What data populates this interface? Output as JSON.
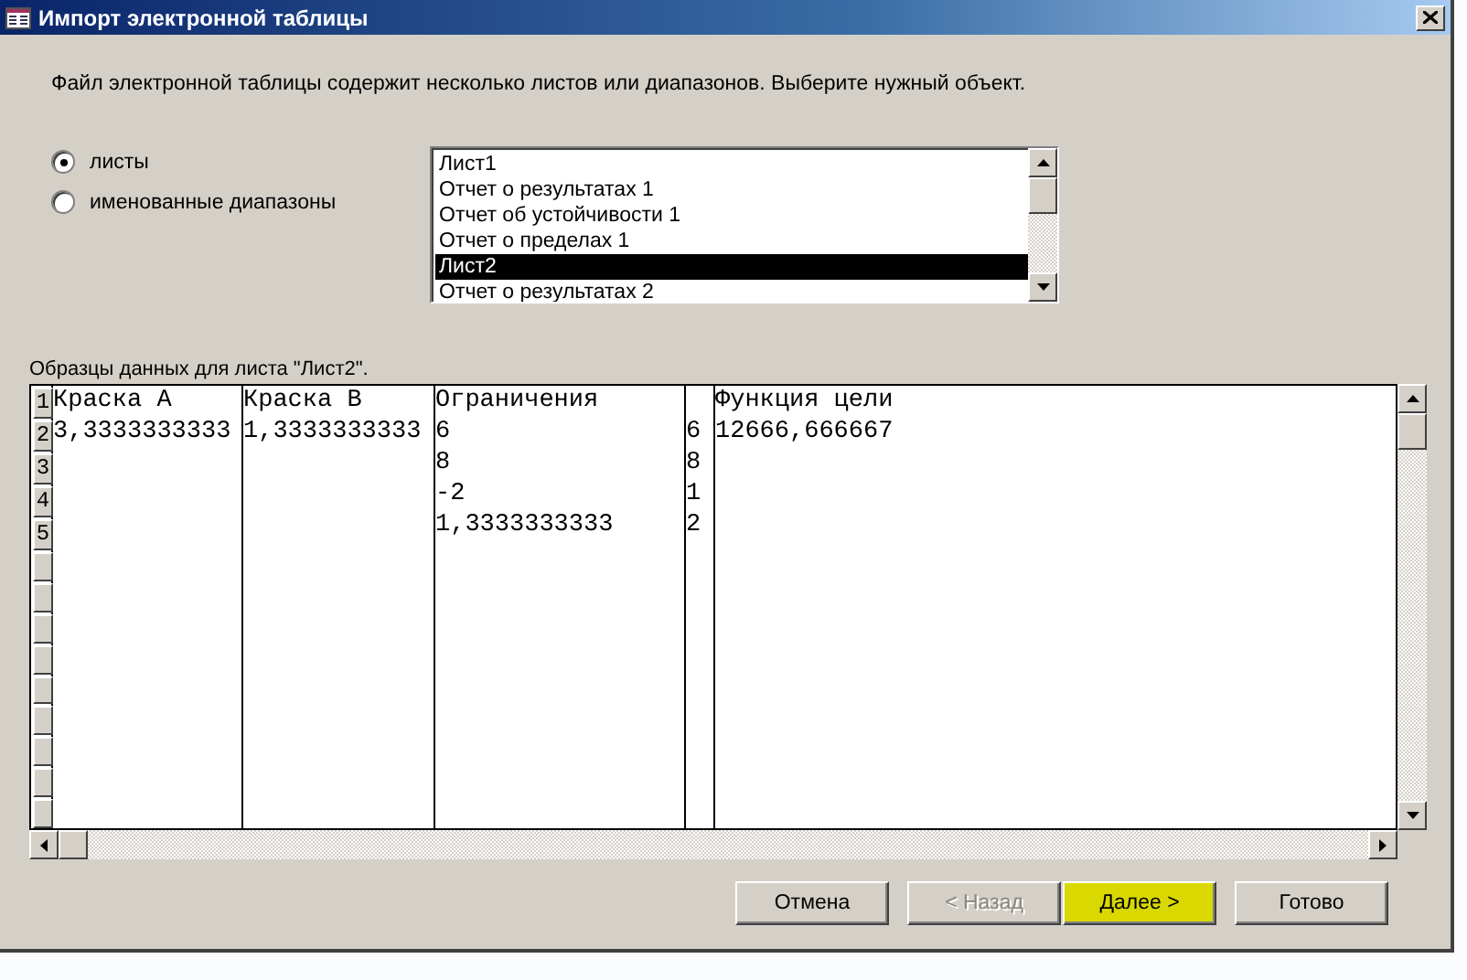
{
  "window": {
    "title": "Импорт электронной таблицы"
  },
  "intro": "Файл электронной таблицы содержит несколько листов или диапазонов.  Выберите нужный объект.",
  "options": [
    {
      "label": "листы",
      "selected": true
    },
    {
      "label": "именованные диапазоны",
      "selected": false
    }
  ],
  "sheets": [
    {
      "label": "Лист1",
      "selected": false
    },
    {
      "label": "Отчет о результатах 1",
      "selected": false
    },
    {
      "label": "Отчет об устойчивости 1",
      "selected": false
    },
    {
      "label": "Отчет о пределах 1",
      "selected": false
    },
    {
      "label": "Лист2",
      "selected": true
    },
    {
      "label": "Отчет о результатах 2",
      "selected": false
    }
  ],
  "preview_label": "Образцы данных для листа \"Лист2\".",
  "preview": {
    "rows": [
      {
        "number": "1",
        "cells": [
          "Краска А",
          "Краска В",
          "Ограничения",
          "",
          "Функция цели"
        ]
      },
      {
        "number": "2",
        "cells": [
          "3,3333333333",
          "1,3333333333",
          "6",
          "6",
          "12666,666667"
        ]
      },
      {
        "number": "3",
        "cells": [
          "",
          "",
          "8",
          "8",
          ""
        ]
      },
      {
        "number": "4",
        "cells": [
          "",
          "",
          "-2",
          "1",
          ""
        ]
      },
      {
        "number": "5",
        "cells": [
          "",
          "",
          "1,3333333333",
          "2",
          ""
        ]
      }
    ]
  },
  "buttons": [
    {
      "label": "Отмена",
      "disabled": false,
      "highlighted": false
    },
    {
      "label": "< Назад",
      "disabled": true,
      "highlighted": false
    },
    {
      "label": "Далее >",
      "disabled": false,
      "highlighted": true
    },
    {
      "label": "Готово",
      "disabled": false,
      "highlighted": false
    }
  ]
}
